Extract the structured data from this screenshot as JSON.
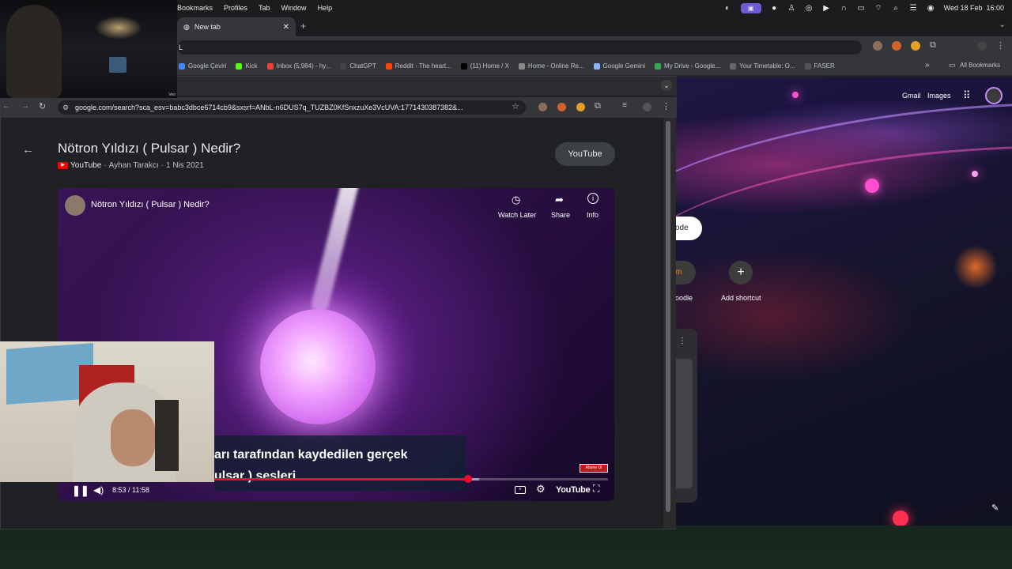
{
  "menubar": {
    "items": [
      "Bookmarks",
      "Profiles",
      "Tab",
      "Window",
      "Help"
    ],
    "clock": "Wed 18 Feb  16:00"
  },
  "back_browser": {
    "tab_title": "New tab",
    "omnibox_value": "L",
    "bookmarks": [
      {
        "label": "Google Çeviri",
        "color": "#4285f4"
      },
      {
        "label": "Kick",
        "color": "#53fc18"
      },
      {
        "label": "Inbox (5,984) - hy...",
        "color": "#ea4335"
      },
      {
        "label": "ChatGPT",
        "color": "#444444"
      },
      {
        "label": "Reddit - The heart...",
        "color": "#ff4500"
      },
      {
        "label": "(11) Home / X",
        "color": "#000000"
      },
      {
        "label": "Home - Online Re...",
        "color": "#888888"
      },
      {
        "label": "Google Gemini",
        "color": "#8ab4f8"
      },
      {
        "label": "My Drive - Google...",
        "color": "#34a853"
      },
      {
        "label": "Your Timetable: O...",
        "color": "#666666"
      },
      {
        "label": "FASER",
        "color": "#555555"
      }
    ],
    "more_bookmarks": "»",
    "all_bookmarks": "All Bookmarks",
    "ntp": {
      "gmail": "Gmail",
      "images": "Images",
      "shortcut_partial_label": "ode",
      "shortcut_moodle": "oodle",
      "add_shortcut": "Add shortcut"
    }
  },
  "front_browser": {
    "url": "google.com/search?sca_esv=babc3dbce6714cb9&sxsrf=ANbL-n6DUS7q_TUZBZ0KfSnxzuXe3VcUVA:1771430387382&...",
    "result": {
      "title": "Nötron Yıldızı ( Pulsar ) Nedir?",
      "source": "YouTube",
      "channel": "Ayhan Tarakcı",
      "date": "1 Nis 2021",
      "open_button": "YouTube"
    },
    "player": {
      "video_title": "Nötron Yıldızı ( Pulsar ) Nedir?",
      "watch_later": "Watch Later",
      "share": "Share",
      "info": "Info",
      "subtitle_line1": "arı tarafından kaydedilen gerçek",
      "subtitle_line2": "ulsar ) sesleri",
      "time": "8:53 / 11:58",
      "progress": 0.742,
      "buffered": 0.762,
      "brand": "YouTube",
      "subscribe_badge": "Abone Ol"
    }
  },
  "webcam_top_label": "Veo"
}
